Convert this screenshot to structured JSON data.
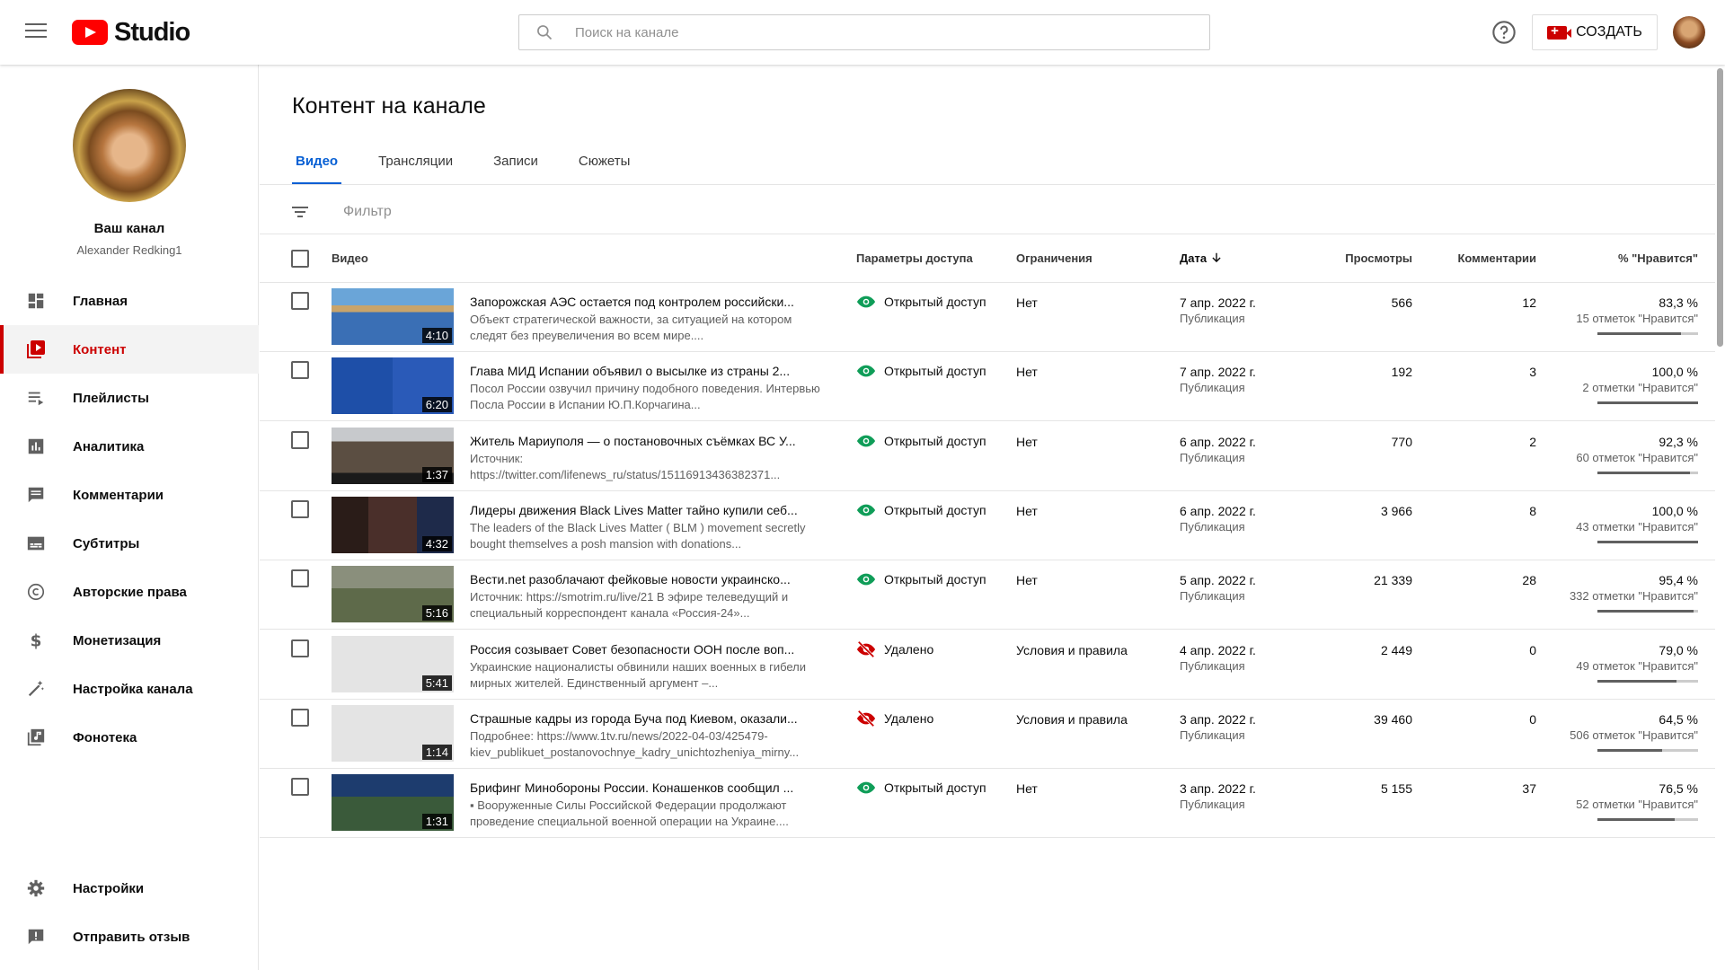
{
  "header": {
    "logo_text": "Studio",
    "search_placeholder": "Поиск на канале",
    "create_label": "СОЗДАТЬ"
  },
  "channel": {
    "name": "Ваш канал",
    "handle": "Alexander Redking1"
  },
  "sidebar": {
    "items": [
      {
        "label": "Главная",
        "icon": "dashboard-icon"
      },
      {
        "label": "Контент",
        "icon": "content-icon",
        "active": true
      },
      {
        "label": "Плейлисты",
        "icon": "playlists-icon"
      },
      {
        "label": "Аналитика",
        "icon": "analytics-icon"
      },
      {
        "label": "Комментарии",
        "icon": "comments-icon"
      },
      {
        "label": "Субтитры",
        "icon": "subtitles-icon"
      },
      {
        "label": "Авторские права",
        "icon": "copyright-icon"
      },
      {
        "label": "Монетизация",
        "icon": "dollar-icon"
      },
      {
        "label": "Настройка канала",
        "icon": "magic-wand-icon"
      },
      {
        "label": "Фонотека",
        "icon": "audio-library-icon"
      }
    ],
    "bottom": [
      {
        "label": "Настройки",
        "icon": "gear-icon"
      },
      {
        "label": "Отправить отзыв",
        "icon": "feedback-icon"
      }
    ]
  },
  "main": {
    "title": "Контент на канале",
    "tabs": [
      {
        "label": "Видео",
        "active": true
      },
      {
        "label": "Трансляции"
      },
      {
        "label": "Записи"
      },
      {
        "label": "Сюжеты"
      }
    ],
    "filter_placeholder": "Фильтр",
    "columns": {
      "video": "Видео",
      "access": "Параметры доступа",
      "restrictions": "Ограничения",
      "date": "Дата",
      "views": "Просмотры",
      "comments": "Комментарии",
      "likes": "% \"Нравится\""
    },
    "rows": [
      {
        "title": "Запорожская АЭС остается под контролем российски...",
        "desc": "Объект стратегической важности, за ситуацией на котором следят без преувеличения во всем мире....",
        "duration": "4:10",
        "visibility": "Открытый доступ",
        "removed": false,
        "restriction": "Нет",
        "date": "7 апр. 2022 г.",
        "status": "Публикация",
        "views": "566",
        "comments": "12",
        "likes_pct": "83,3 %",
        "likes_count": "15 отметок \"Нравится\"",
        "like_ratio": 0.833
      },
      {
        "title": "Глава МИД Испании объявил о высылке из страны 2...",
        "desc": "Посол России озвучил причину подобного поведения. Интервью Посла России в Испании Ю.П.Корчагина...",
        "duration": "6:20",
        "visibility": "Открытый доступ",
        "removed": false,
        "restriction": "Нет",
        "date": "7 апр. 2022 г.",
        "status": "Публикация",
        "views": "192",
        "comments": "3",
        "likes_pct": "100,0 %",
        "likes_count": "2 отметки \"Нравится\"",
        "like_ratio": 1.0
      },
      {
        "title": "Житель Мариуполя — о постановочных съёмках ВС У...",
        "desc": "Источник: https://twitter.com/lifenews_ru/status/15116913436382371...",
        "duration": "1:37",
        "visibility": "Открытый доступ",
        "removed": false,
        "restriction": "Нет",
        "date": "6 апр. 2022 г.",
        "status": "Публикация",
        "views": "770",
        "comments": "2",
        "likes_pct": "92,3 %",
        "likes_count": "60 отметок \"Нравится\"",
        "like_ratio": 0.923
      },
      {
        "title": "Лидеры движения Black Lives Matter тайно купили себ...",
        "desc": "The leaders of the Black Lives Matter ( BLM ) movement secretly bought themselves a posh mansion with donations...",
        "duration": "4:32",
        "visibility": "Открытый доступ",
        "removed": false,
        "restriction": "Нет",
        "date": "6 апр. 2022 г.",
        "status": "Публикация",
        "views": "3 966",
        "comments": "8",
        "likes_pct": "100,0 %",
        "likes_count": "43 отметки \"Нравится\"",
        "like_ratio": 1.0
      },
      {
        "title": "Вести.net разоблачают фейковые новости украинско...",
        "desc": "Источник: https://smotrim.ru/live/21 В эфире телеведущий и специальный корреспондент канала «Россия-24»...",
        "duration": "5:16",
        "visibility": "Открытый доступ",
        "removed": false,
        "restriction": "Нет",
        "date": "5 апр. 2022 г.",
        "status": "Публикация",
        "views": "21 339",
        "comments": "28",
        "likes_pct": "95,4 %",
        "likes_count": "332 отметки \"Нравится\"",
        "like_ratio": 0.954
      },
      {
        "title": "Россия созывает Совет безопасности ООН после воп...",
        "desc": "Украинские националисты обвинили наших военных в гибели мирных жителей. Единственный аргумент –...",
        "duration": "5:41",
        "visibility": "Удалено",
        "removed": true,
        "restriction": "Условия и правила",
        "date": "4 апр. 2022 г.",
        "status": "Публикация",
        "views": "2 449",
        "comments": "0",
        "likes_pct": "79,0 %",
        "likes_count": "49 отметок \"Нравится\"",
        "like_ratio": 0.79
      },
      {
        "title": "Страшные кадры из города Буча под Киевом, оказали...",
        "desc": "Подробнее: https://www.1tv.ru/news/2022-04-03/425479-kiev_publikuet_postanovochnye_kadry_unichtozheniya_mirny...",
        "duration": "1:14",
        "visibility": "Удалено",
        "removed": true,
        "restriction": "Условия и правила",
        "date": "3 апр. 2022 г.",
        "status": "Публикация",
        "views": "39 460",
        "comments": "0",
        "likes_pct": "64,5 %",
        "likes_count": "506 отметок \"Нравится\"",
        "like_ratio": 0.645
      },
      {
        "title": "Брифинг Минобороны России. Конашенков сообщил ...",
        "desc": "▪ Вооруженные Силы Российской Федерации продолжают проведение специальной военной операции на Украине....",
        "duration": "1:31",
        "visibility": "Открытый доступ",
        "removed": false,
        "restriction": "Нет",
        "date": "3 апр. 2022 г.",
        "status": "Публикация",
        "views": "5 155",
        "comments": "37",
        "likes_pct": "76,5 %",
        "likes_count": "52 отметки \"Нравится\"",
        "like_ratio": 0.765
      }
    ]
  },
  "colors": {
    "accent_red": "#cc0000",
    "tab_blue": "#065fd4",
    "public_green": "#0f9d58",
    "removed_red": "#cc0000"
  }
}
